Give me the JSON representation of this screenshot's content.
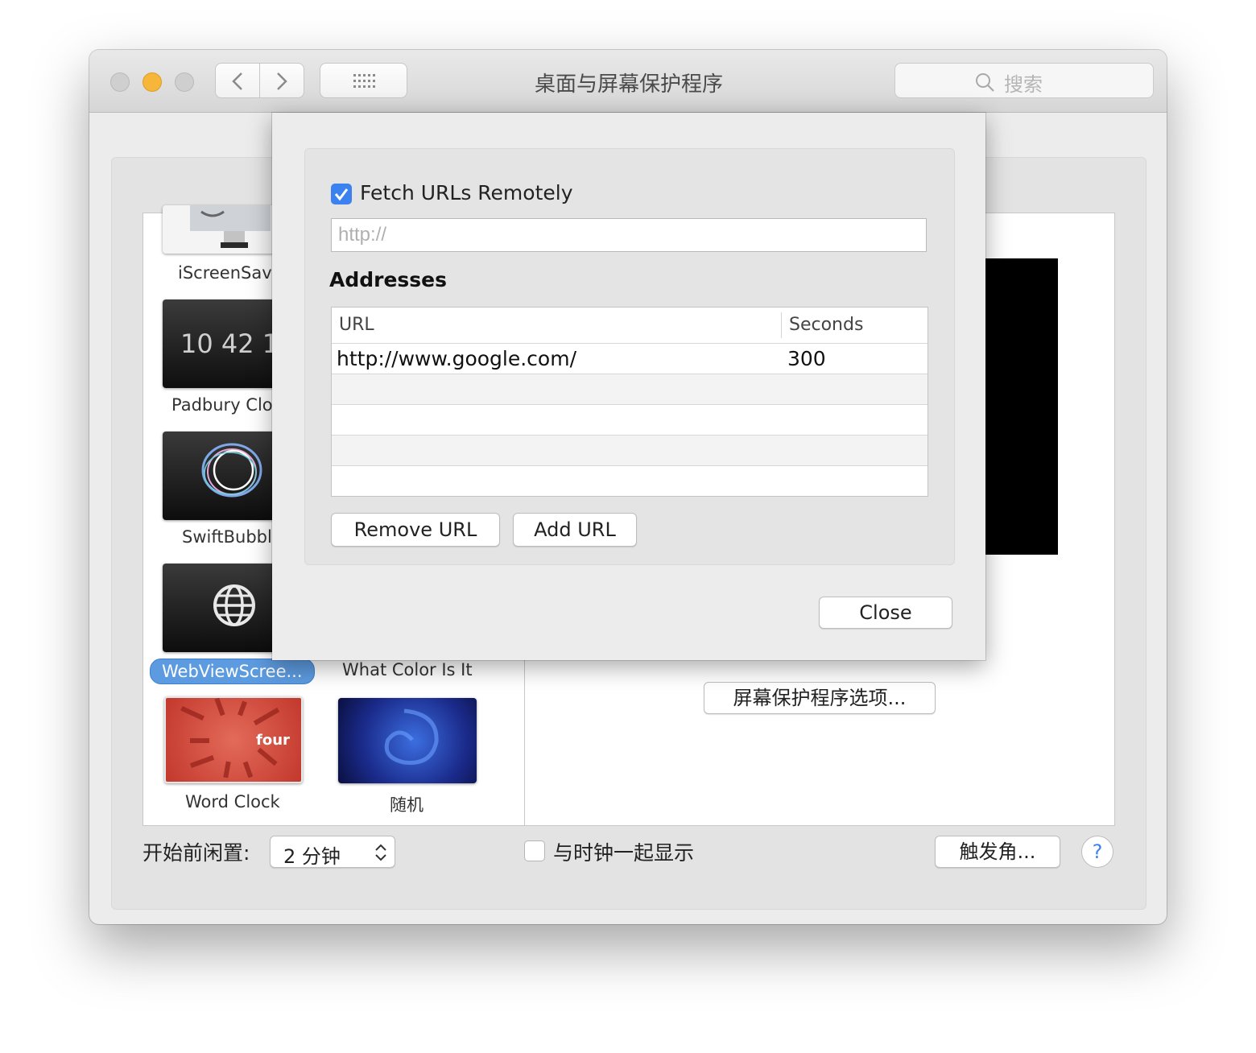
{
  "window": {
    "title": "桌面与屏幕保护程序",
    "search_placeholder": "搜索"
  },
  "screensavers": [
    {
      "label": "iScreenSav"
    },
    {
      "label": "Padbury Clo",
      "thumb_text": "10 42 1"
    },
    {
      "label": "SwiftBubbl"
    },
    {
      "label": "WebViewScree...",
      "selected": true
    },
    {
      "label": "What Color Is It"
    },
    {
      "label": "Word Clock",
      "thumb_text": "four"
    },
    {
      "label": "随机"
    }
  ],
  "options_button": "屏幕保护程序选项...",
  "bottom": {
    "idle_label": "开始前闲置:",
    "idle_value": "2 分钟",
    "show_clock_label": "与时钟一起显示",
    "show_clock_checked": false,
    "hot_corners": "触发角...",
    "help": "?"
  },
  "sheet": {
    "fetch_label": "Fetch URLs Remotely",
    "fetch_checked": true,
    "url_placeholder": "http://",
    "addresses_heading": "Addresses",
    "columns": [
      "URL",
      "Seconds"
    ],
    "rows": [
      {
        "url": "http://www.google.com/",
        "seconds": "300"
      }
    ],
    "remove_button": "Remove URL",
    "add_button": "Add URL",
    "close_button": "Close"
  },
  "colors": {
    "traffic_close": "#cfcfcf",
    "traffic_minimize": "#f5b63a",
    "traffic_zoom": "#cfcfcf",
    "checkbox_accent": "#3b82f0",
    "selection": "#5d9be0"
  }
}
